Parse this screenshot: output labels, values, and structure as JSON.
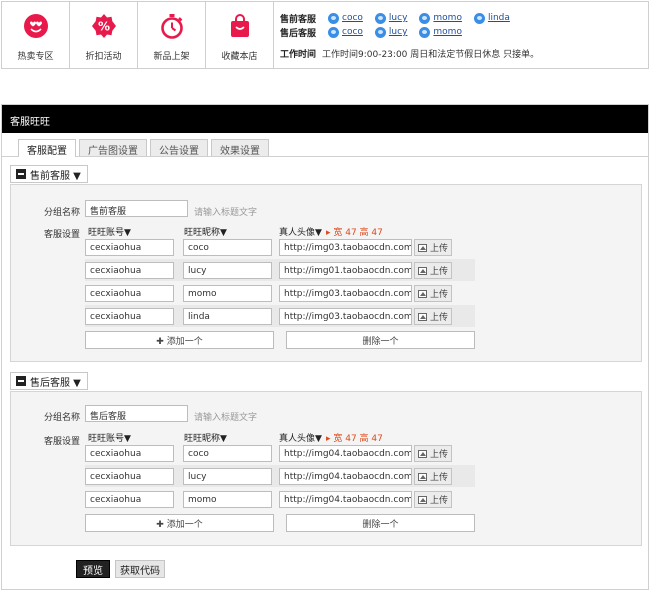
{
  "nav": [
    {
      "label": "热卖专区",
      "icon": "heart-smile-icon"
    },
    {
      "label": "折扣活动",
      "icon": "discount-percent-icon"
    },
    {
      "label": "新品上架",
      "icon": "stopwatch-icon"
    },
    {
      "label": "收藏本店",
      "icon": "shopping-bag-icon"
    }
  ],
  "support": {
    "presale_title": "售前客服",
    "presale_names": [
      "coco",
      "lucy",
      "momo",
      "linda"
    ],
    "aftersale_title": "售后客服",
    "aftersale_names": [
      "coco",
      "lucy",
      "momo"
    ],
    "hours_title": "工作时间",
    "hours_text": "工作时间9:00-23:00 周日和法定节假日休息 只接单。"
  },
  "panel": {
    "title": "客服旺旺",
    "tabs": [
      "客服配置",
      "广告图设置",
      "公告设置",
      "效果设置"
    ]
  },
  "labels": {
    "group_name": "分组名称",
    "service_settings": "客服设置",
    "hint": "请输入标题文字",
    "col_account": "旺旺账号▼",
    "col_nickname": "旺旺昵称▼",
    "col_avatar": "真人头像▼",
    "size_tip": "▸ 宽 47 高 47",
    "upload": "上传",
    "add_one": "✚ 添加一个",
    "delete_one": "删除一个"
  },
  "groups": [
    {
      "header": "售前客服 ▼",
      "name_value": "售前客服",
      "rows": [
        {
          "account": "cecxiaohua",
          "nickname": "coco",
          "avatar": "http://img03.taobaocdn.com/img"
        },
        {
          "account": "cecxiaohua",
          "nickname": "lucy",
          "avatar": "http://img01.taobaocdn.com/img"
        },
        {
          "account": "cecxiaohua",
          "nickname": "momo",
          "avatar": "http://img03.taobaocdn.com/img"
        },
        {
          "account": "cecxiaohua",
          "nickname": "linda",
          "avatar": "http://img03.taobaocdn.com/img"
        }
      ]
    },
    {
      "header": "售后客服 ▼",
      "name_value": "售后客服",
      "rows": [
        {
          "account": "cecxiaohua",
          "nickname": "coco",
          "avatar": "http://img04.taobaocdn.com/img"
        },
        {
          "account": "cecxiaohua",
          "nickname": "lucy",
          "avatar": "http://img04.taobaocdn.com/img"
        },
        {
          "account": "cecxiaohua",
          "nickname": "momo",
          "avatar": "http://img04.taobaocdn.com/img"
        }
      ]
    }
  ],
  "actions": {
    "preview": "预览",
    "get_code": "获取代码"
  }
}
